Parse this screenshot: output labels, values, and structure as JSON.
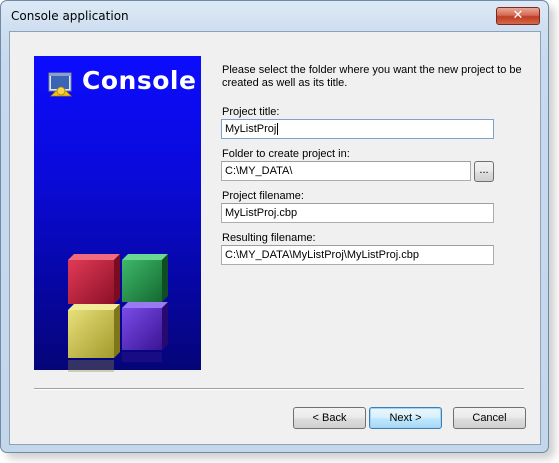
{
  "window": {
    "title": "Console application",
    "close_label": "✕"
  },
  "banner": {
    "title": "Console"
  },
  "intro_text": "Please select the folder where you want the new project to be created as well as its title.",
  "fields": {
    "project_title": {
      "label": "Project title:",
      "value": "MyListProj"
    },
    "folder": {
      "label": "Folder to create project in:",
      "value": "C:\\MY_DATA\\",
      "browse_label": "..."
    },
    "project_filename": {
      "label": "Project filename:",
      "value": "MyListProj.cbp"
    },
    "resulting_filename": {
      "label": "Resulting filename:",
      "value": "C:\\MY_DATA\\MyListProj\\MyListProj.cbp"
    }
  },
  "buttons": {
    "back": "< Back",
    "next": "Next >",
    "cancel": "Cancel"
  },
  "colors": {
    "banner_blue": "#0c0cff",
    "close_red": "#c03c22",
    "focus_border": "#7da2ce"
  }
}
